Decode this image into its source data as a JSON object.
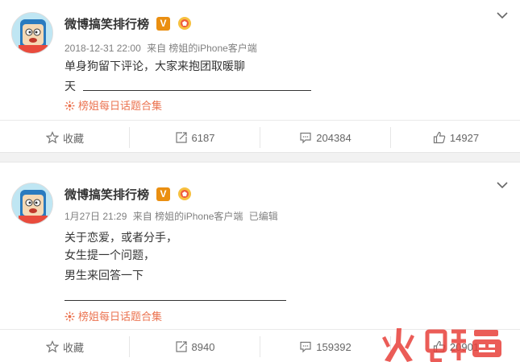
{
  "posts": [
    {
      "author": "微博搞笑排行榜",
      "verified_badge": "V",
      "timestamp": "2018-12-31 22:00",
      "source": "来自 榜姐的iPhone客户端",
      "edited": "",
      "lines": [
        "单身狗留下评论，大家来抱团取暖聊",
        "天"
      ],
      "topic": "榜姐每日话题合集",
      "actions": {
        "favorite": "收藏",
        "repost": "6187",
        "comment": "204384",
        "like": "14927"
      }
    },
    {
      "author": "微博搞笑排行榜",
      "verified_badge": "V",
      "timestamp": "1月27日 21:29",
      "source": "来自 榜姐的iPhone客户端",
      "edited": "已编辑",
      "lines": [
        "关于恋爱，或者分手，",
        "女生提一个问题，",
        "男生来回答一下"
      ],
      "topic": "榜姐每日话题合集",
      "actions": {
        "favorite": "收藏",
        "repost": "8940",
        "comment": "159392",
        "like": "20901"
      }
    }
  ],
  "watermark": "火鲤鱼",
  "colors": {
    "accent": "#eb7350",
    "badge": "#ea8f11",
    "watermark": "#e8403a"
  }
}
